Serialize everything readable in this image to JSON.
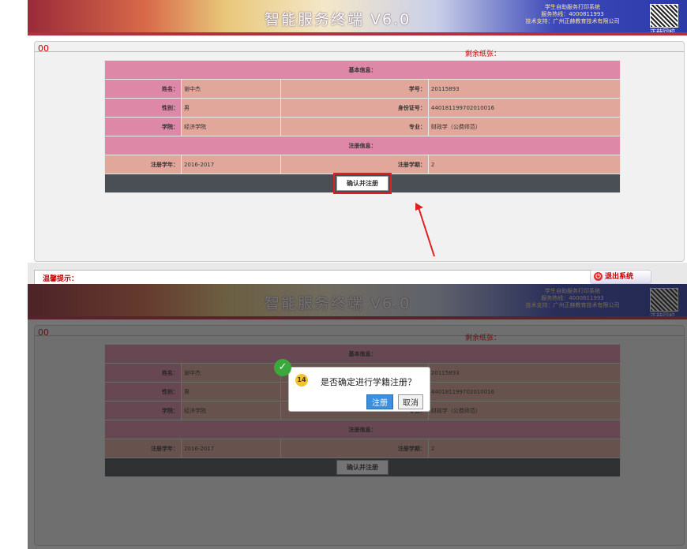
{
  "app": {
    "title": "智能服务终端 V6.0",
    "info_line1": "学生自助服务打印系统",
    "info_line2": "服务热线：4000811993",
    "info_line3": "技术支持：广州正赫教育技术有限公司",
    "qr_label": "正赫回校"
  },
  "content": {
    "code": "00",
    "remaining_label": "剩余纸张："
  },
  "basic_info": {
    "section_title": "基本信息：",
    "name_label": "姓名：",
    "name_value": "谢中杰",
    "student_id_label": "学号：",
    "student_id_value": "20115893",
    "gender_label": "性别：",
    "gender_value": "男",
    "id_card_label": "身份证号：",
    "id_card_value": "440181199702010016",
    "college_label": "学院：",
    "college_value": "经济学院",
    "major_label": "专业：",
    "major_value": "财政学（公费师范）"
  },
  "registration": {
    "section_title": "注册信息：",
    "year_label": "注册学年：",
    "year_value": "2016-2017",
    "term_label": "注册学期：",
    "term_value": "2",
    "button_label": "确认并注册"
  },
  "footer": {
    "tips_label": "温馨提示：",
    "exit_label": "退出系统"
  },
  "dialog": {
    "icon_text": "14",
    "message": "是否确定进行学籍注册？",
    "ok_label": "注册",
    "cancel_label": "取消"
  }
}
